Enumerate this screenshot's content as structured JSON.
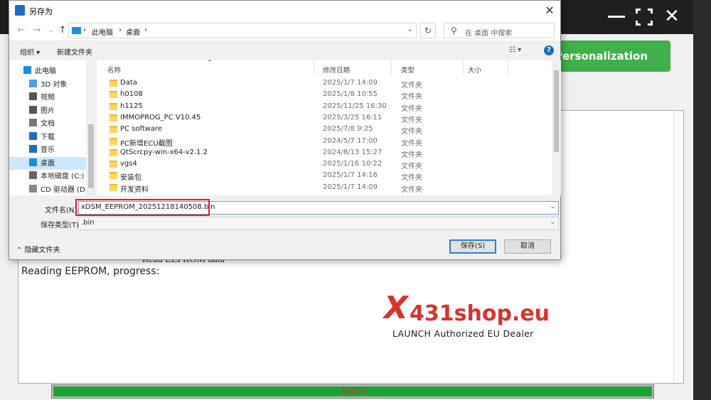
{
  "app": {
    "personalization_label": "Personalization",
    "log": {
      "line1": "Read EEPROM data",
      "line2": "Reading EEPROM, progress:"
    },
    "progress": {
      "value": 1.0,
      "text": "100%"
    }
  },
  "watermark": {
    "x": "X",
    "brand": "431shop.eu",
    "sub": "LAUNCH Authorized EU Dealer"
  },
  "dialog": {
    "title": "另存为",
    "breadcrumb": [
      "此电脑",
      "桌面"
    ],
    "search_placeholder": "在 桌面 中搜索",
    "toolbar": {
      "organize": "组织 ▾",
      "new_folder": "新建文件夹"
    },
    "nav_items": [
      {
        "label": "此电脑",
        "icon": "pc-icon"
      },
      {
        "label": "3D 对象",
        "icon": "3d-objects-icon"
      },
      {
        "label": "视频",
        "icon": "video-icon"
      },
      {
        "label": "图片",
        "icon": "pictures-icon"
      },
      {
        "label": "文档",
        "icon": "documents-icon"
      },
      {
        "label": "下载",
        "icon": "download-icon"
      },
      {
        "label": "音乐",
        "icon": "music-icon"
      },
      {
        "label": "桌面",
        "icon": "desktop-icon",
        "selected": true
      },
      {
        "label": "本地磁盘 (C:)",
        "icon": "drive-icon"
      },
      {
        "label": "CD 驱动器 (D:)",
        "icon": "cd-drive-icon"
      }
    ],
    "columns": {
      "name": "名称",
      "modified": "修改日期",
      "type": "类型",
      "size": "大小"
    },
    "files": [
      {
        "name": "Data",
        "modified": "2025/1/7 14:09",
        "type": "文件夹"
      },
      {
        "name": "h0108",
        "modified": "2025/1/8 10:55",
        "type": "文件夹"
      },
      {
        "name": "h1125",
        "modified": "2025/11/25 16:30",
        "type": "文件夹"
      },
      {
        "name": "IMMOPROG_PC  V10.45",
        "modified": "2025/3/25 16:11",
        "type": "文件夹"
      },
      {
        "name": "PC software",
        "modified": "2025/7/8 9:25",
        "type": "文件夹"
      },
      {
        "name": "PC新增ECU截图",
        "modified": "2024/5/7 17:00",
        "type": "文件夹"
      },
      {
        "name": "QtScrcpy-win-x64-v2.1.2",
        "modified": "2024/8/13 15:27",
        "type": "文件夹"
      },
      {
        "name": "vgs4",
        "modified": "2025/1/16 10:22",
        "type": "文件夹"
      },
      {
        "name": "安装包",
        "modified": "2025/1/7 14:16",
        "type": "文件夹"
      },
      {
        "name": "开发资料",
        "modified": "2025/1/7 14:09",
        "type": "文件夹"
      }
    ],
    "filename_label": "文件名(N):",
    "filename_value": "xDSM_EEPROM_20251218140508.bin",
    "filetype_label": "保存类型(T):",
    "filetype_value": ".bin",
    "hide_folders": "隐藏文件夹",
    "save_label": "保存(S)",
    "cancel_label": "取消"
  }
}
